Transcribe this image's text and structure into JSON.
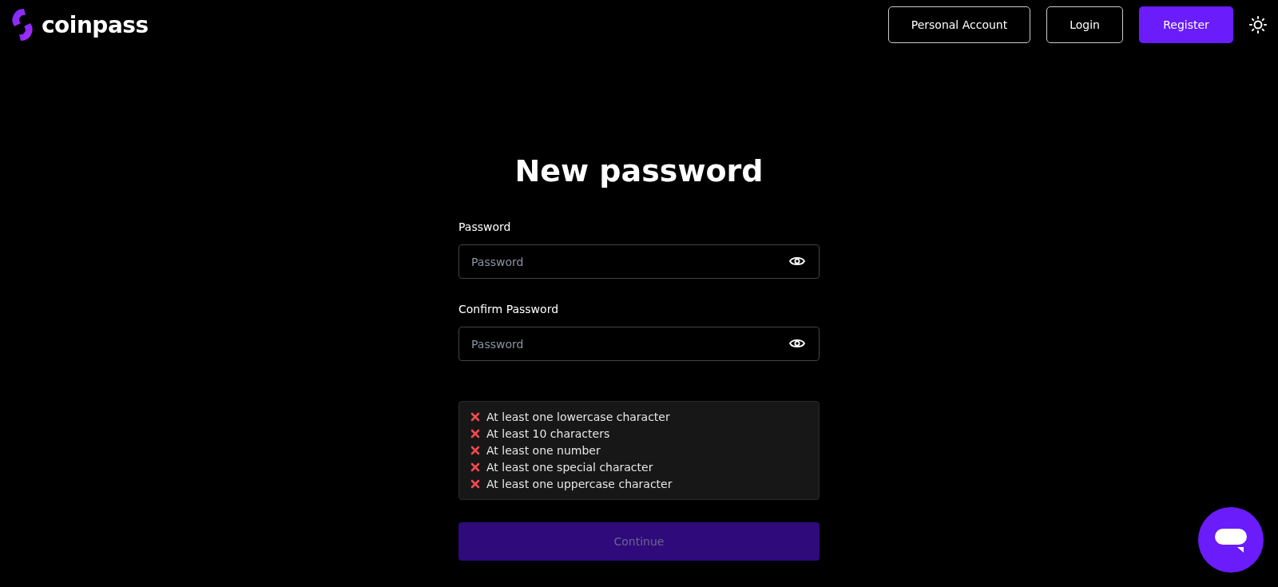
{
  "header": {
    "logo": "coinpass",
    "buttons": [
      {
        "label": "Personal Account",
        "kind": "outline"
      },
      {
        "label": "Login",
        "kind": "outline"
      },
      {
        "label": "Register",
        "kind": "primary"
      }
    ]
  },
  "form": {
    "title": "New password",
    "fields": [
      {
        "label": "Password",
        "placeholder": "Password"
      },
      {
        "label": "Confirm Password",
        "placeholder": "Password"
      }
    ],
    "requirements": [
      {
        "text": "At least one lowercase character",
        "met": false
      },
      {
        "text": "At least 10 characters",
        "met": false
      },
      {
        "text": "At least one number",
        "met": false
      },
      {
        "text": "At least one special character",
        "met": false
      },
      {
        "text": "At least one uppercase character",
        "met": false
      }
    ],
    "submit": {
      "label": "Continue",
      "disabled": true
    }
  }
}
